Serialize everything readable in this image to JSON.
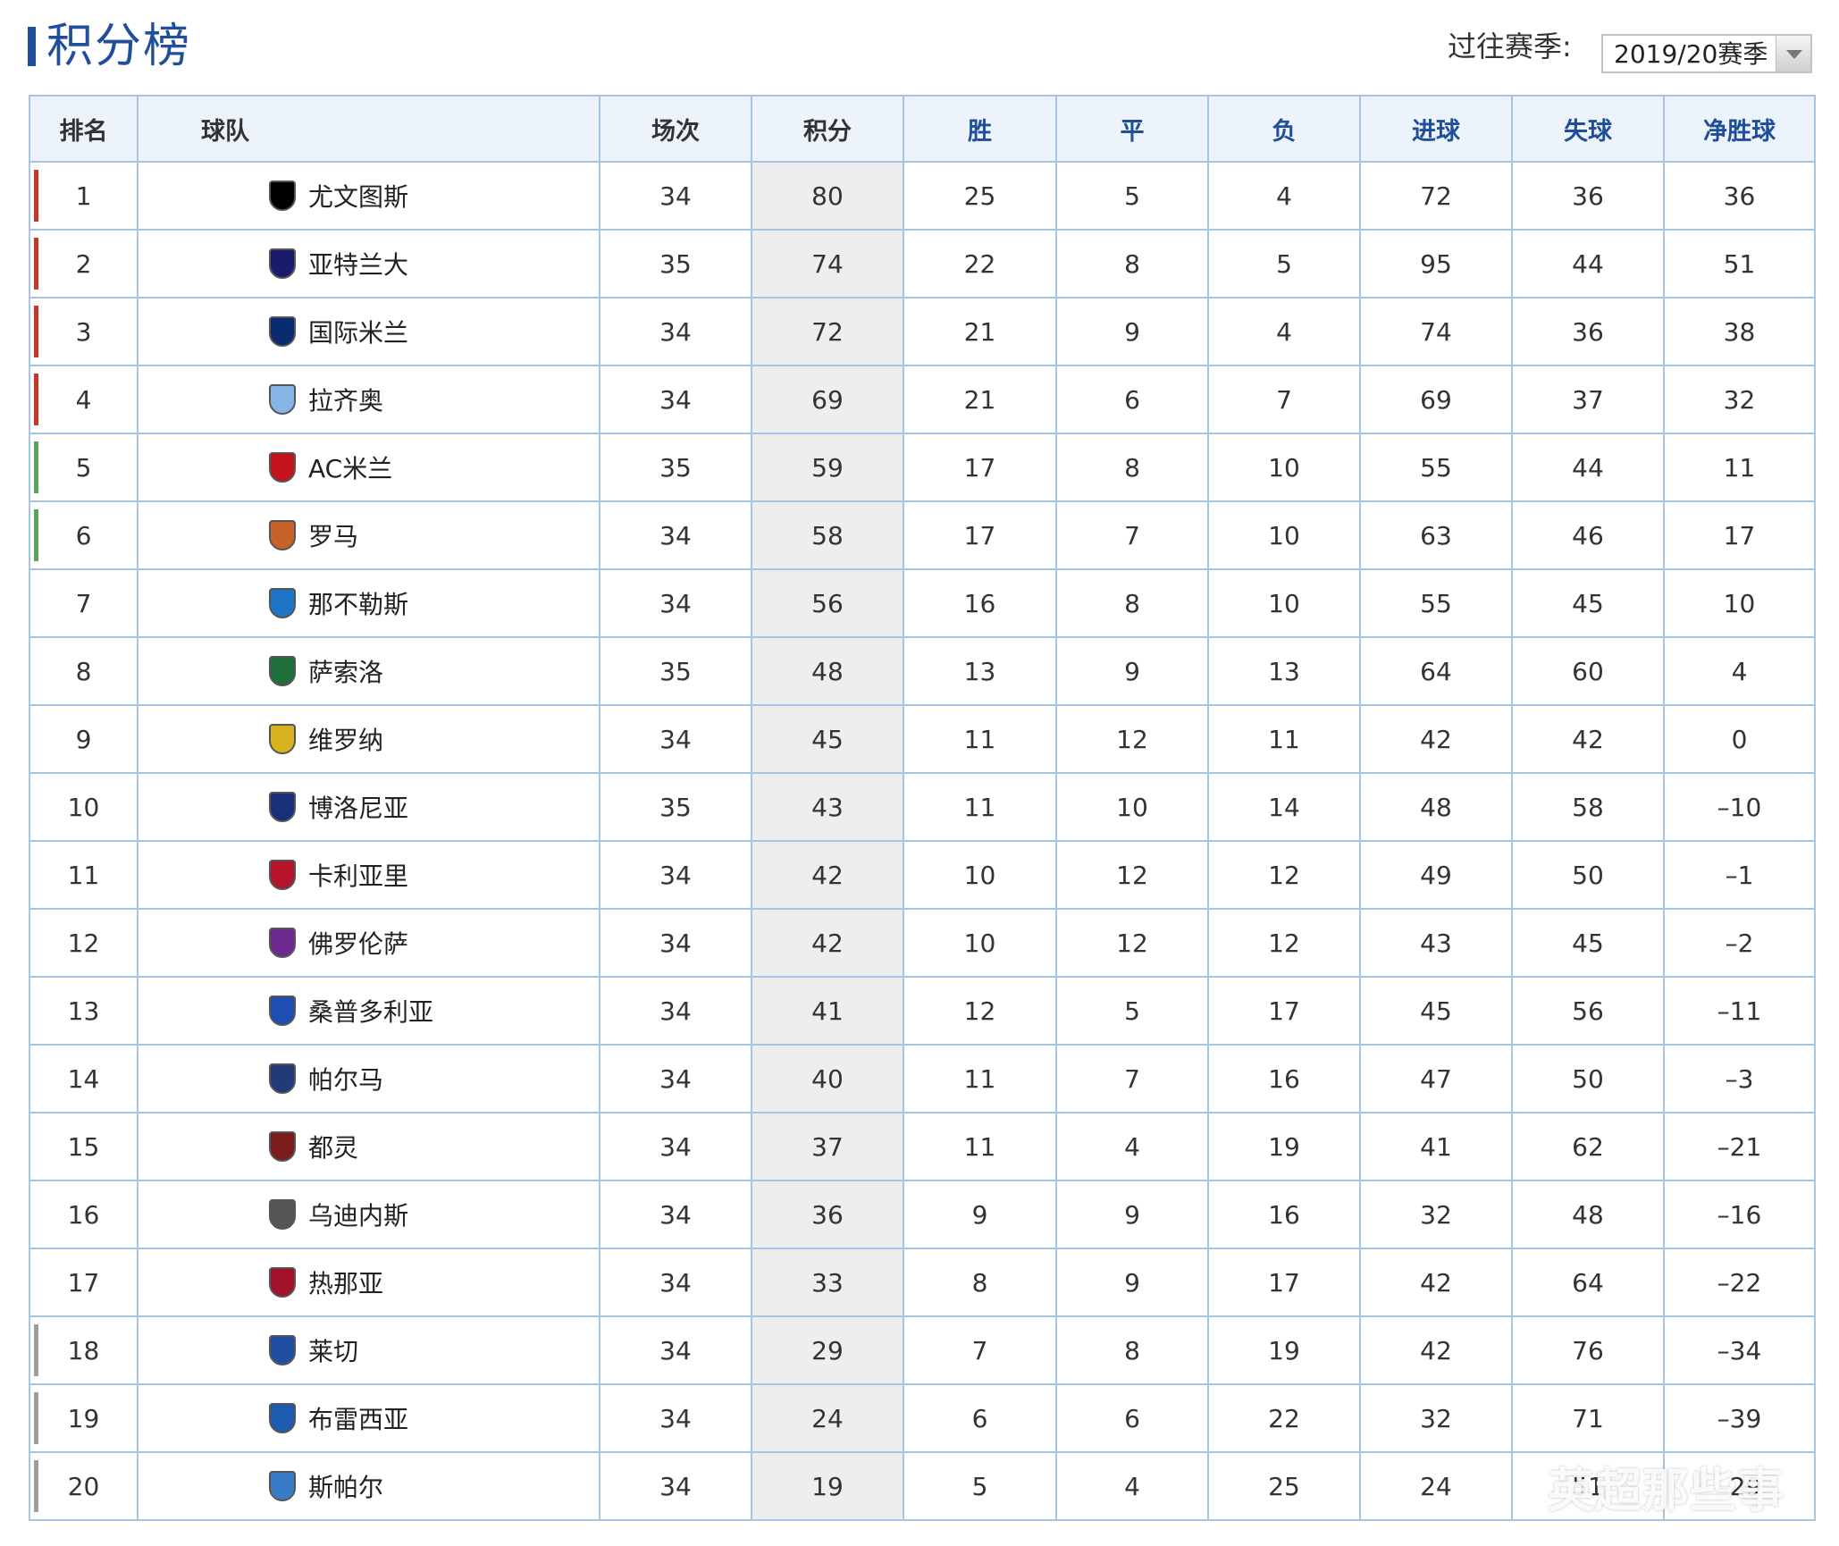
{
  "page": {
    "title": "积分榜"
  },
  "season": {
    "label": "过往赛季:",
    "selected": "2019/20赛季"
  },
  "colors": {
    "accent": "#1f4f9c",
    "ucl_marker": "#c0392b",
    "uel_marker": "#5aa35a",
    "relegation_marker": "#9e9e9e",
    "border": "#a9c4e2"
  },
  "table": {
    "headers": {
      "rank": "排名",
      "team": "球队",
      "played": "场次",
      "points": "积分",
      "won": "胜",
      "drawn": "平",
      "lost": "负",
      "gf": "进球",
      "ga": "失球",
      "gd": "净胜球"
    },
    "rows": [
      {
        "rank": "1",
        "team": "尤文图斯",
        "crest": "juventus-crest-icon",
        "crest_color": "#000000",
        "played": "34",
        "points": "80",
        "won": "25",
        "drawn": "5",
        "lost": "4",
        "gf": "72",
        "ga": "36",
        "gd": "36",
        "zone": "ucl"
      },
      {
        "rank": "2",
        "team": "亚特兰大",
        "crest": "atalanta-crest-icon",
        "crest_color": "#1b1b6b",
        "played": "35",
        "points": "74",
        "won": "22",
        "drawn": "8",
        "lost": "5",
        "gf": "95",
        "ga": "44",
        "gd": "51",
        "zone": "ucl"
      },
      {
        "rank": "3",
        "team": "国际米兰",
        "crest": "inter-crest-icon",
        "crest_color": "#0a2b6e",
        "played": "34",
        "points": "72",
        "won": "21",
        "drawn": "9",
        "lost": "4",
        "gf": "74",
        "ga": "36",
        "gd": "38",
        "zone": "ucl"
      },
      {
        "rank": "4",
        "team": "拉齐奥",
        "crest": "lazio-crest-icon",
        "crest_color": "#86b6e8",
        "played": "34",
        "points": "69",
        "won": "21",
        "drawn": "6",
        "lost": "7",
        "gf": "69",
        "ga": "37",
        "gd": "32",
        "zone": "ucl"
      },
      {
        "rank": "5",
        "team": "AC米兰",
        "crest": "ac-milan-crest-icon",
        "crest_color": "#c4141b",
        "played": "35",
        "points": "59",
        "won": "17",
        "drawn": "8",
        "lost": "10",
        "gf": "55",
        "ga": "44",
        "gd": "11",
        "zone": "uel"
      },
      {
        "rank": "6",
        "team": "罗马",
        "crest": "roma-crest-icon",
        "crest_color": "#c9612b",
        "played": "34",
        "points": "58",
        "won": "17",
        "drawn": "7",
        "lost": "10",
        "gf": "63",
        "ga": "46",
        "gd": "17",
        "zone": "uel"
      },
      {
        "rank": "7",
        "team": "那不勒斯",
        "crest": "napoli-crest-icon",
        "crest_color": "#1c74c6",
        "played": "34",
        "points": "56",
        "won": "16",
        "drawn": "8",
        "lost": "10",
        "gf": "55",
        "ga": "45",
        "gd": "10",
        "zone": ""
      },
      {
        "rank": "8",
        "team": "萨索洛",
        "crest": "sassuolo-crest-icon",
        "crest_color": "#1e6d3a",
        "played": "35",
        "points": "48",
        "won": "13",
        "drawn": "9",
        "lost": "13",
        "gf": "64",
        "ga": "60",
        "gd": "4",
        "zone": ""
      },
      {
        "rank": "9",
        "team": "维罗纳",
        "crest": "verona-crest-icon",
        "crest_color": "#d8b21e",
        "played": "34",
        "points": "45",
        "won": "11",
        "drawn": "12",
        "lost": "11",
        "gf": "42",
        "ga": "42",
        "gd": "0",
        "zone": ""
      },
      {
        "rank": "10",
        "team": "博洛尼亚",
        "crest": "bologna-crest-icon",
        "crest_color": "#1a2f7a",
        "played": "35",
        "points": "43",
        "won": "11",
        "drawn": "10",
        "lost": "14",
        "gf": "48",
        "ga": "58",
        "gd": "–10",
        "zone": ""
      },
      {
        "rank": "11",
        "team": "卡利亚里",
        "crest": "cagliari-crest-icon",
        "crest_color": "#b5122b",
        "played": "34",
        "points": "42",
        "won": "10",
        "drawn": "12",
        "lost": "12",
        "gf": "49",
        "ga": "50",
        "gd": "–1",
        "zone": ""
      },
      {
        "rank": "12",
        "team": "佛罗伦萨",
        "crest": "fiorentina-crest-icon",
        "crest_color": "#6c2a8f",
        "played": "34",
        "points": "42",
        "won": "10",
        "drawn": "12",
        "lost": "12",
        "gf": "43",
        "ga": "45",
        "gd": "–2",
        "zone": ""
      },
      {
        "rank": "13",
        "team": "桑普多利亚",
        "crest": "sampdoria-crest-icon",
        "crest_color": "#1d4fb3",
        "played": "34",
        "points": "41",
        "won": "12",
        "drawn": "5",
        "lost": "17",
        "gf": "45",
        "ga": "56",
        "gd": "–11",
        "zone": ""
      },
      {
        "rank": "14",
        "team": "帕尔马",
        "crest": "parma-crest-icon",
        "crest_color": "#233a7a",
        "played": "34",
        "points": "40",
        "won": "11",
        "drawn": "7",
        "lost": "16",
        "gf": "47",
        "ga": "50",
        "gd": "–3",
        "zone": ""
      },
      {
        "rank": "15",
        "team": "都灵",
        "crest": "torino-crest-icon",
        "crest_color": "#7a1c1c",
        "played": "34",
        "points": "37",
        "won": "11",
        "drawn": "4",
        "lost": "19",
        "gf": "41",
        "ga": "62",
        "gd": "–21",
        "zone": ""
      },
      {
        "rank": "16",
        "team": "乌迪内斯",
        "crest": "udinese-crest-icon",
        "crest_color": "#555555",
        "played": "34",
        "points": "36",
        "won": "9",
        "drawn": "9",
        "lost": "16",
        "gf": "32",
        "ga": "48",
        "gd": "–16",
        "zone": ""
      },
      {
        "rank": "17",
        "team": "热那亚",
        "crest": "genoa-crest-icon",
        "crest_color": "#a3122b",
        "played": "34",
        "points": "33",
        "won": "8",
        "drawn": "9",
        "lost": "17",
        "gf": "42",
        "ga": "64",
        "gd": "–22",
        "zone": ""
      },
      {
        "rank": "18",
        "team": "莱切",
        "crest": "lecce-crest-icon",
        "crest_color": "#1e4fa3",
        "played": "34",
        "points": "29",
        "won": "7",
        "drawn": "8",
        "lost": "19",
        "gf": "42",
        "ga": "76",
        "gd": "–34",
        "zone": "rel"
      },
      {
        "rank": "19",
        "team": "布雷西亚",
        "crest": "brescia-crest-icon",
        "crest_color": "#1c5bb0",
        "played": "34",
        "points": "24",
        "won": "6",
        "drawn": "6",
        "lost": "22",
        "gf": "32",
        "ga": "71",
        "gd": "–39",
        "zone": "rel"
      },
      {
        "rank": "20",
        "team": "斯帕尔",
        "crest": "spal-crest-icon",
        "crest_color": "#3a7bc8",
        "played": "34",
        "points": "19",
        "won": "5",
        "drawn": "4",
        "lost": "25",
        "gf": "24",
        "ga": "51",
        "gd": "–29",
        "zone": "rel"
      }
    ]
  },
  "watermark": {
    "text": "英超那些事"
  }
}
